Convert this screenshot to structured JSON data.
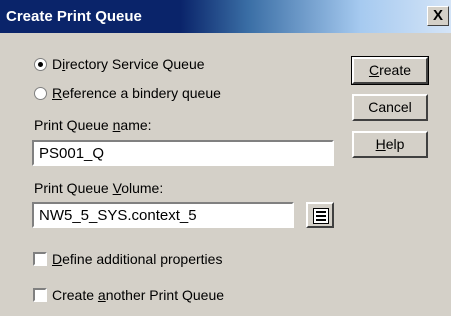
{
  "window": {
    "title": "Create Print Queue",
    "close_glyph": "X"
  },
  "queue_type": {
    "options": [
      {
        "prefix": "D",
        "accel": "i",
        "rest": "rectory Service Queue",
        "selected": true
      },
      {
        "prefix": "",
        "accel": "R",
        "rest": "eference a bindery queue",
        "selected": false
      }
    ]
  },
  "queue_name": {
    "label_prefix": "Print Queue ",
    "label_accel": "n",
    "label_rest": "ame:",
    "value": "PS001_Q"
  },
  "queue_volume": {
    "label_prefix": "Print Queue ",
    "label_accel": "V",
    "label_rest": "olume:",
    "value": "NW5_5_SYS.context_5",
    "browse_icon": "browse-tree-icon"
  },
  "options": {
    "define_props": {
      "prefix": "",
      "accel": "D",
      "rest": "efine additional properties",
      "checked": false
    },
    "create_another": {
      "prefix": "Create ",
      "accel": "a",
      "rest": "nother Print Queue",
      "checked": false
    }
  },
  "buttons": {
    "create": {
      "accel": "C",
      "rest": "reate"
    },
    "cancel": {
      "label": "Cancel"
    },
    "help": {
      "accel": "H",
      "rest": "elp"
    }
  }
}
